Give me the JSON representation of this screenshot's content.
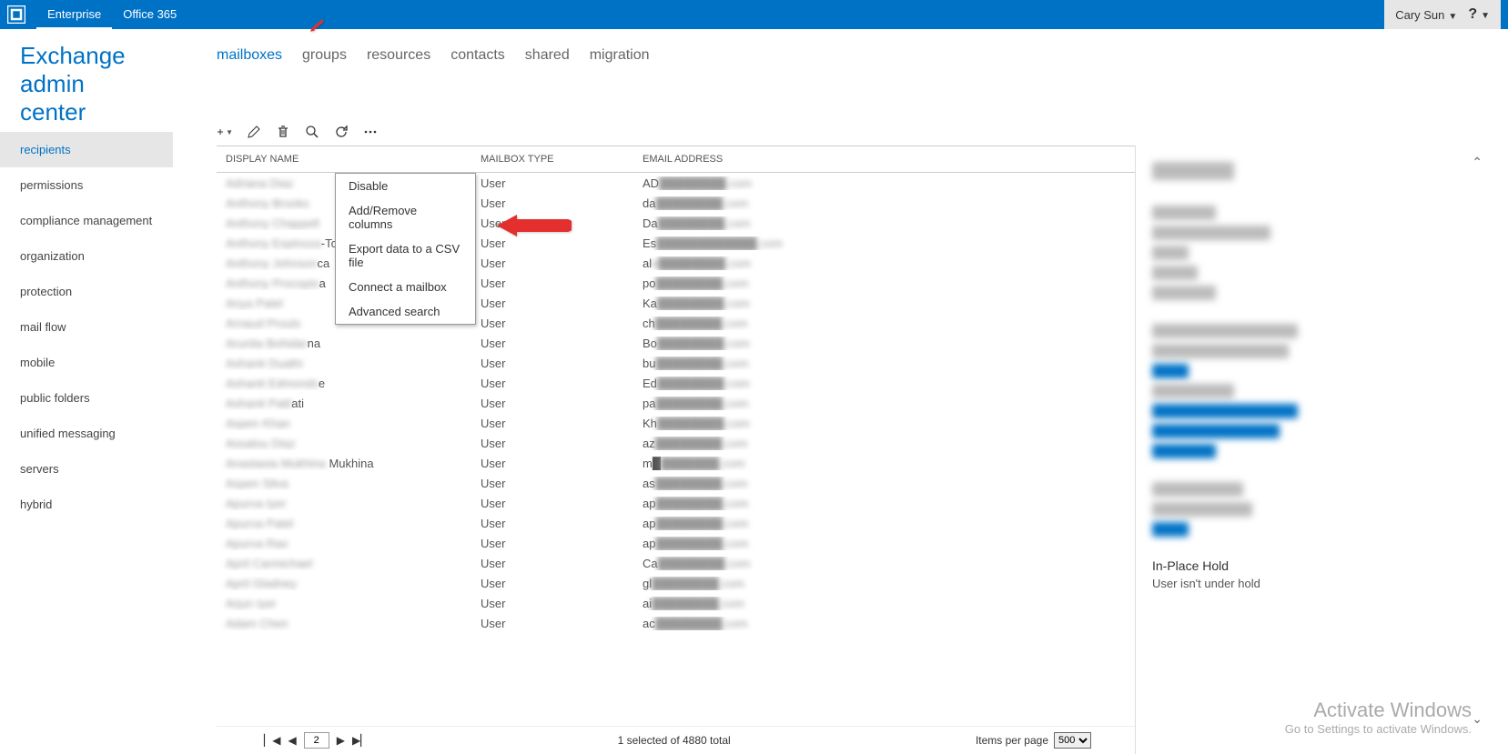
{
  "topbar": {
    "tab1": "Enterprise",
    "tab2": "Office 365",
    "user": "Cary Sun",
    "help": "?"
  },
  "page_title": "Exchange admin center",
  "sidebar": {
    "items": [
      "recipients",
      "permissions",
      "compliance management",
      "organization",
      "protection",
      "mail flow",
      "mobile",
      "public folders",
      "unified messaging",
      "servers",
      "hybrid"
    ]
  },
  "subtabs": [
    "mailboxes",
    "groups",
    "resources",
    "contacts",
    "shared",
    "migration"
  ],
  "table": {
    "headers": {
      "name": "DISPLAY NAME",
      "type": "MAILBOX TYPE",
      "email": "EMAIL ADDRESS"
    },
    "rows": [
      {
        "name": "Adriana Diaz",
        "name_suffix": "",
        "type": "User",
        "email": "AD████████.com"
      },
      {
        "name": "Anthony Brooks",
        "name_suffix": "",
        "type": "User",
        "email": "da████████.com"
      },
      {
        "name": "Anthony Chappell",
        "name_suffix": "",
        "type": "User",
        "email": "Da████████.com"
      },
      {
        "name": "Anthony Espinoza",
        "name_suffix": "-Torres",
        "type": "User",
        "email": "Es████████████.com"
      },
      {
        "name": "Anthony Johnson",
        "name_suffix": "ca",
        "type": "User",
        "email": "ale████████.com"
      },
      {
        "name": "Anthony Procopio",
        "name_suffix": "a",
        "type": "User",
        "email": "po████████.com"
      },
      {
        "name": "Anya Patel",
        "name_suffix": "",
        "type": "User",
        "email": "Ka████████.com"
      },
      {
        "name": "Arnaud Proulx",
        "name_suffix": "",
        "type": "User",
        "email": "ch████████.com"
      },
      {
        "name": "Arunita Bohidar",
        "name_suffix": "na",
        "type": "User",
        "email": "Bo████████.com"
      },
      {
        "name": "Ashanti Duathi",
        "name_suffix": "",
        "type": "User",
        "email": "bu████████.com"
      },
      {
        "name": "Ashanti Edmonds",
        "name_suffix": "e",
        "type": "User",
        "email": "Ed████████.com"
      },
      {
        "name": "Ashanti Patil",
        "name_suffix": "ati",
        "type": "User",
        "email": "pa████████.com"
      },
      {
        "name": "Aspen Khan",
        "name_suffix": "",
        "type": "User",
        "email": "Kh████████.com"
      },
      {
        "name": "Assatou Diaz",
        "name_suffix": "",
        "type": "User",
        "email": "az████████.com"
      },
      {
        "name": "Anastasia Mukhina",
        "name_suffix": " Mukhina",
        "type": "User",
        "email": "m████████.com"
      },
      {
        "name": "Aspen Silva",
        "name_suffix": "",
        "type": "User",
        "email": "as████████.com"
      },
      {
        "name": "Apurva Iyer",
        "name_suffix": "",
        "type": "User",
        "email": "ap████████.com"
      },
      {
        "name": "Apurva Patel",
        "name_suffix": "",
        "type": "User",
        "email": "ap████████.com"
      },
      {
        "name": "Apurva Rao",
        "name_suffix": "",
        "type": "User",
        "email": "ap████████.com"
      },
      {
        "name": "April Carmichael",
        "name_suffix": "",
        "type": "User",
        "email": "Ca████████.com"
      },
      {
        "name": "April Gladney",
        "name_suffix": "",
        "type": "User",
        "email": "gl████████.com"
      },
      {
        "name": "Arjun Iyer",
        "name_suffix": "",
        "type": "User",
        "email": "ai████████.com"
      },
      {
        "name": "Adam Chen",
        "name_suffix": "",
        "type": "User",
        "email": "ac████████.com"
      }
    ]
  },
  "dropdown": {
    "items": [
      "Disable",
      "Add/Remove columns",
      "Export data to a CSV file",
      "Connect a mailbox",
      "Advanced search"
    ]
  },
  "details": {
    "hold_header": "In-Place Hold",
    "hold_text": "User isn't under hold"
  },
  "pager": {
    "page": "2",
    "status": "1 selected of 4880 total",
    "ipp_label": "Items per page",
    "ipp_value": "500"
  },
  "watermark": {
    "l1": "Activate Windows",
    "l2": "Go to Settings to activate Windows."
  }
}
